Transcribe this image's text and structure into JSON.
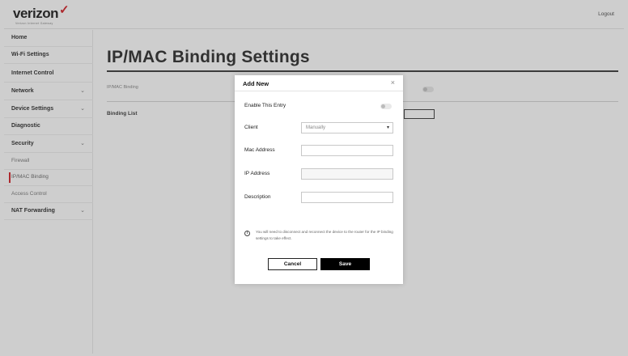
{
  "header": {
    "logo_text": "verizon",
    "logo_check": "✓",
    "logo_tagline": "Verizon Internet Gateway",
    "logout_label": "Logout"
  },
  "sidebar": {
    "items": [
      {
        "label": "Home",
        "chevron": ""
      },
      {
        "label": "Wi-Fi Settings",
        "chevron": ""
      },
      {
        "label": "Internet Control",
        "chevron": ""
      },
      {
        "label": "Network",
        "chevron": "⌄"
      },
      {
        "label": "Device Settings",
        "chevron": "⌄"
      },
      {
        "label": "Diagnostic",
        "chevron": ""
      },
      {
        "label": "Security",
        "chevron": "⌄"
      },
      {
        "label": "Firewall",
        "chevron": ""
      },
      {
        "label": "IP/MAC Binding",
        "chevron": ""
      },
      {
        "label": "Access Control",
        "chevron": ""
      },
      {
        "label": "NAT Forwarding",
        "chevron": "⌄"
      }
    ]
  },
  "main": {
    "page_title": "IP/MAC Binding Settings",
    "binding_label": "IP/MAC Binding",
    "binding_list_label": "Binding List"
  },
  "modal": {
    "title": "Add New",
    "close_glyph": "×",
    "enable_label": "Enable This Entry",
    "enable_state": false,
    "client_label": "Client",
    "client_value": "Manually",
    "client_caret": "▾",
    "mac_label": "Mac Address",
    "mac_value": "",
    "ip_label": "IP Address",
    "ip_value": "",
    "description_label": "Description",
    "description_value": "",
    "info_glyph": "i",
    "info_text": "You will need to disconnect and reconnect the device to the router for the IP binding settings to take effect.",
    "cancel_label": "Cancel",
    "save_label": "Save"
  },
  "colors": {
    "brand_red": "#cd040b",
    "primary_button": "#000000"
  }
}
